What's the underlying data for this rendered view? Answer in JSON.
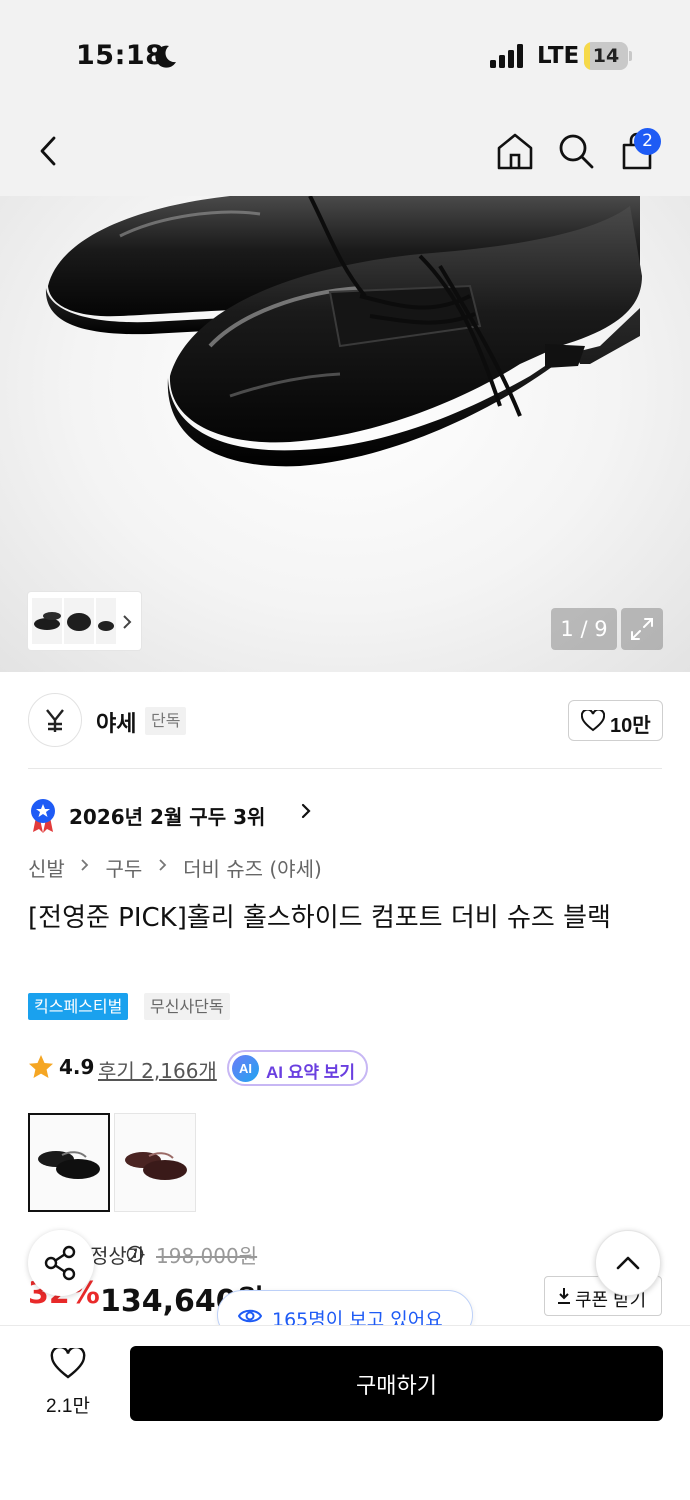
{
  "status_bar": {
    "time": "15:18",
    "network": "LTE",
    "battery": "14",
    "battery_level": 0.14
  },
  "header": {
    "cart_count": "2"
  },
  "gallery": {
    "counter": "1 / 9"
  },
  "brand": {
    "name": "야세",
    "tag": "단독",
    "likes": "10만"
  },
  "rank": {
    "text": "2026년 2월 구두 3위"
  },
  "breadcrumb": [
    "신발",
    "구두",
    "더비 슈즈 (야세)"
  ],
  "product": {
    "title": "[전영준 PICK]홀리 홀스하이드 컴포트 더비 슈즈 블랙",
    "badges": {
      "festival": "킥스페스티벌",
      "exclusive": "무신사단독"
    },
    "rating": "4.9",
    "reviews": "후기 2,166개",
    "ai_summary": "AI 요약 보기",
    "ai_badge": "AI",
    "price_label": "정상가",
    "original_price": "198,000원",
    "discount": "32%",
    "price": "134,640원",
    "coupon": "쿠폰 받기",
    "viewers": "165명이 보고 있어요"
  },
  "bottom_bar": {
    "wish_count": "2.1만",
    "buy_label": "구매하기"
  },
  "colors": {
    "accent_blue": "#1e5bf5",
    "discount_red": "#e92a2a",
    "festival_blue": "#1aa1ee",
    "ai_purple": "#6a3fe0"
  }
}
